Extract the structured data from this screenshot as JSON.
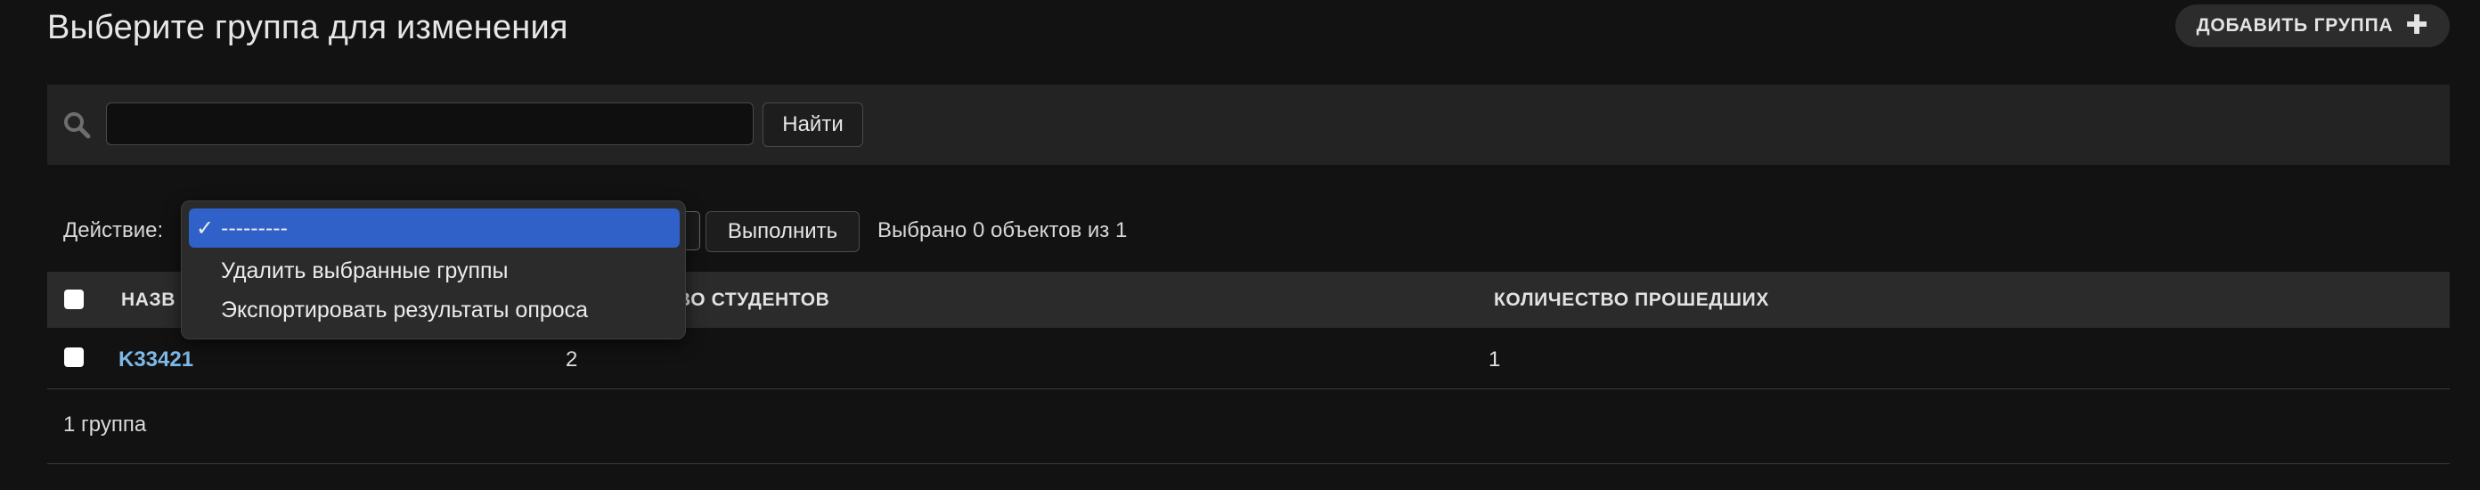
{
  "header": {
    "title": "Выберите группа для изменения",
    "add_button_label": "ДОБАВИТЬ ГРУППА",
    "add_button_icon": "plus-icon"
  },
  "search": {
    "value": "",
    "placeholder": "",
    "button_label": "Найти",
    "icon": "search-icon"
  },
  "actions": {
    "label": "Действие:",
    "go_label": "Выполнить",
    "counter": "Выбрано 0 объектов из 1",
    "options": [
      {
        "check": "✓",
        "label": "---------",
        "selected": true
      },
      {
        "check": "",
        "label": "Удалить выбранные группы",
        "selected": false
      },
      {
        "check": "",
        "label": "Экспортировать результаты опроса",
        "selected": false
      }
    ]
  },
  "table": {
    "columns": [
      "НАЗВ",
      "ВО СТУДЕНТОВ",
      "КОЛИЧЕСТВО ПРОШЕДШИХ"
    ],
    "rows": [
      {
        "name": "K33421",
        "students": "2",
        "passed": "1"
      }
    ]
  },
  "footer": {
    "count_text": "1 группа"
  },
  "colors": {
    "background": "#121212",
    "accent": "#2f61c9",
    "link": "#7fb8e6"
  }
}
